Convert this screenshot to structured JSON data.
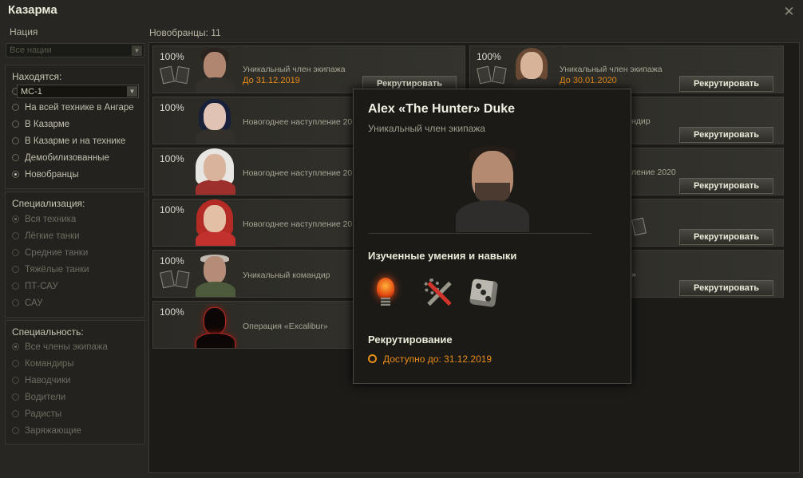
{
  "window": {
    "title": "Казарма"
  },
  "filters": {
    "nation_label": "Нация",
    "nation_value": "Все нации",
    "location": {
      "header": "Находятся:",
      "vehicle_value": "МС-1",
      "options": [
        "На всей технике в Ангаре",
        "В Казарме",
        "В Казарме и на технике",
        "Демобилизованные",
        "Новобранцы"
      ],
      "selected": "Новобранцы"
    },
    "specialization": {
      "header": "Специализация:",
      "options": [
        "Вся техника",
        "Лёгкие танки",
        "Средние танки",
        "Тяжёлые танки",
        "ПТ-САУ",
        "САУ"
      ],
      "selected": "Вся техника"
    },
    "role": {
      "header": "Специальность:",
      "options": [
        "Все члены экипажа",
        "Командиры",
        "Наводчики",
        "Водители",
        "Радисты",
        "Заряжающие"
      ],
      "selected": "Все члены экипажа"
    }
  },
  "recruits_header": "Новобранцы: 11",
  "recruit_button_label": "Рекрутировать",
  "cards_left": [
    {
      "percent": "100%",
      "name": "Уникальный член экипажа",
      "date": "До 31.12.2019",
      "portrait": "man-dark-hair-beard",
      "has_documents": true
    },
    {
      "percent": "100%",
      "name": "Новогоднее наступление 2020",
      "date": "",
      "portrait": "woman-blue-hair",
      "has_documents": false
    },
    {
      "percent": "100%",
      "name": "Новогоднее наступление 2020",
      "date": "",
      "portrait": "woman-fur-hood",
      "has_documents": false
    },
    {
      "percent": "100%",
      "name": "Новогоднее наступление 2020",
      "date": "",
      "portrait": "woman-red-hood",
      "has_documents": false
    },
    {
      "percent": "100%",
      "name": "Уникальный командир",
      "date": "",
      "portrait": "man-bald-uniform",
      "has_documents": true
    },
    {
      "percent": "100%",
      "name": "Операция «Excalibur»",
      "date": "",
      "portrait": "silhouette",
      "has_documents": false
    }
  ],
  "cards_right": [
    {
      "percent": "100%",
      "name": "Уникальный член экипажа",
      "date": "До 30.01.2020",
      "portrait": "woman-light-hair",
      "has_documents": true
    },
    {
      "percent": "",
      "name": "ндир",
      "date": "",
      "has_documents": false
    },
    {
      "percent": "",
      "name": "ление 2020",
      "date": "",
      "has_documents": false
    },
    {
      "percent": "",
      "name": "",
      "date": "",
      "has_documents": true
    },
    {
      "percent": "",
      "name": "»",
      "date": "",
      "has_documents": true
    }
  ],
  "tooltip": {
    "name": "Alex «The Hunter» Duke",
    "subtitle": "Уникальный член экипажа",
    "skills_header": "Изученные умения и навыки",
    "skills": [
      "lightbulb-icon",
      "repair-tools-icon",
      "dice-icon"
    ],
    "recruit_header": "Рекрутирование",
    "available": "Доступно до: 31.12.2019"
  },
  "colors": {
    "accent_orange": "#e88c1a",
    "background": "#272622",
    "panel": "#23221e"
  }
}
